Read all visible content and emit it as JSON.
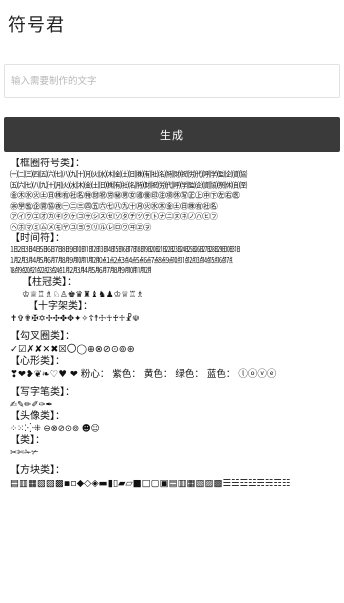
{
  "app": {
    "title": "符号君"
  },
  "input": {
    "placeholder": "输入需要制作的文字",
    "value": ""
  },
  "generate": {
    "label": "生成"
  },
  "sections": {
    "frame": {
      "title": "【框圈符号类】：",
      "lines": [
        "㈠㈡㈢㈣㈤㈥㈦㈧㈨㈩㈪㈫㈬㈭㈮㈯㈰㈱㈲㈳㈴㈵㈶㈷㈸㈹㈺㈻㈼㈽㈾㈿",
        "㈤㈥㈦㈧㈨㈩㈪㈫㈬㈭㈮㈯㈰㈱㈲㈳㈴㈵㈶㈷㈸㈹㈺㈻㈼㈽㈾㈿㉀㉁㉂㉃",
        "㊎㊍㊌㊋㊏㊐㊑㊒㊓㊔㊕㊖㊗㊘㊙㊚㊛㊜㊝㊞㊟㊠㊡㊢㊣㊤㊥㊦㊧㊨㊩",
        "㊪㊫㊬㊭㊮㊯㊰㊀㊁㊂㊃㊄㊅㊆㊇㊈㊉㊊㊋㊌㊍㊎㊏㊐㊑㊒㊓㊔",
        "㋐㋑㋒㋓㋔㋕㋖㋗㋘㋙㋚㋛㋜㋝㋞㋟㋠㋡㋢㋣㋤㋥㋦㋧㋨㋩㋪㋫",
        "㋬㋭㋮㋯㋰㋱㋲㋳㋴㋵㋶㋷㋸㋹㋺㋻㋼㋽㋾"
      ]
    },
    "time": {
      "title": "【时间符】：",
      "lines": [
        "㏠㏡㏢㏣㏤㏥㏦㏧㏨㏩㏪㏫㏬㏭㏮㏯㏰㏱㏲㏳㏴㏵㏶㏷㏸㏹㏺㏻㏼㏽㏾",
        "㋀㋁㋂㋃㋄㋅㋆㋇㋈㋉㋊㋋㍘㍙㍚㍛㍜㍝㍞㍟㍠㍡㍢㍣㍤㍥㍦㍧㍨㍩",
        "㍪㍫㍬㍭㍮㍯㍰㋀㋁㋂㋃㋄㋅㋆㋇㋈㋉㋊㋋"
      ]
    },
    "crown": {
      "title": "【柱冠类】：",
      "lines": [
        "♔♕♖♗♘♙♚♛♜♝♞♟♔♕♖♗"
      ]
    },
    "cross": {
      "title": "【十字架类】：",
      "lines": [
        "✝✞✟✠✡✢✣✤✥✦✧☦☨☩☥♰♱☧☫"
      ]
    },
    "check": {
      "title": "【勾叉圈类】：",
      "lines": [
        "✓☑✗✘✕✖☒〇◯⊕⊗⊘⊙⊚⊛"
      ]
    },
    "heart": {
      "title": "【心形类】：",
      "lines": [
        "❣❤❥❦❧♡♥ ❤ 粉心： 紫色： 黄色： 绿色： 蓝色： ⓛⓞⓥⓔ"
      ]
    },
    "write": {
      "title": "【写字笔类】：",
      "lines": [
        "✍✎✏✐✑✒"
      ]
    },
    "avatar": {
      "title": "【头像类】：",
      "lines": [
        "⁘⁙⁚⁛⁜ ⊖⊗⊘⊙⊚ ☻☺"
      ]
    },
    "misc": {
      "title": "【类】：",
      "lines": [
        "✂✄✁✃"
      ]
    },
    "block": {
      "title": "【方块类】：",
      "lines": [
        "▤▥▦▧▨▩▪▫◆◇◈▬▮▯▰▱■□▢▣▤▥▦▧▨▩☰☱☲☳☴☵☶☷"
      ]
    }
  }
}
